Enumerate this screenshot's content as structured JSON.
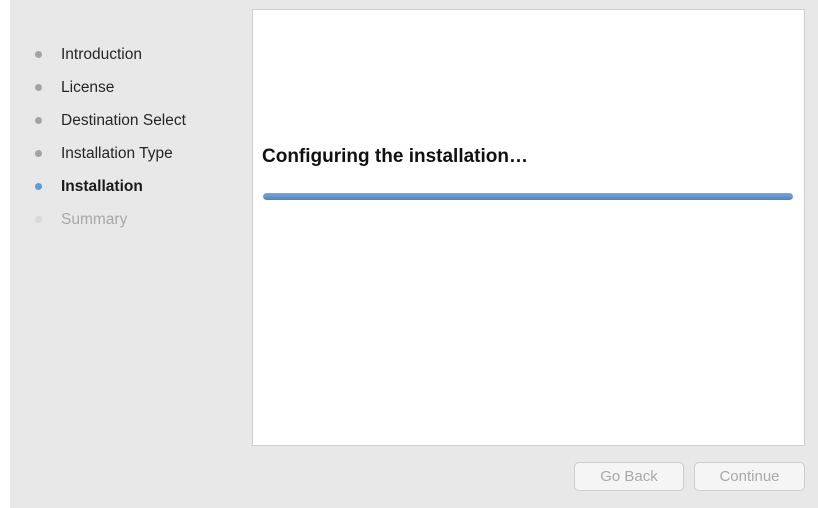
{
  "sidebar": {
    "steps": [
      {
        "label": "Introduction",
        "state": "completed"
      },
      {
        "label": "License",
        "state": "completed"
      },
      {
        "label": "Destination Select",
        "state": "completed"
      },
      {
        "label": "Installation Type",
        "state": "completed"
      },
      {
        "label": "Installation",
        "state": "active"
      },
      {
        "label": "Summary",
        "state": "pending"
      }
    ]
  },
  "main": {
    "status": "Configuring the installation…",
    "progress": 1.0
  },
  "buttons": {
    "back_label": "Go Back",
    "continue_label": "Continue"
  },
  "colors": {
    "accent": "#5b9bd8",
    "progress_fill": "#4d84c3",
    "window_background": "#e8e8e8"
  }
}
